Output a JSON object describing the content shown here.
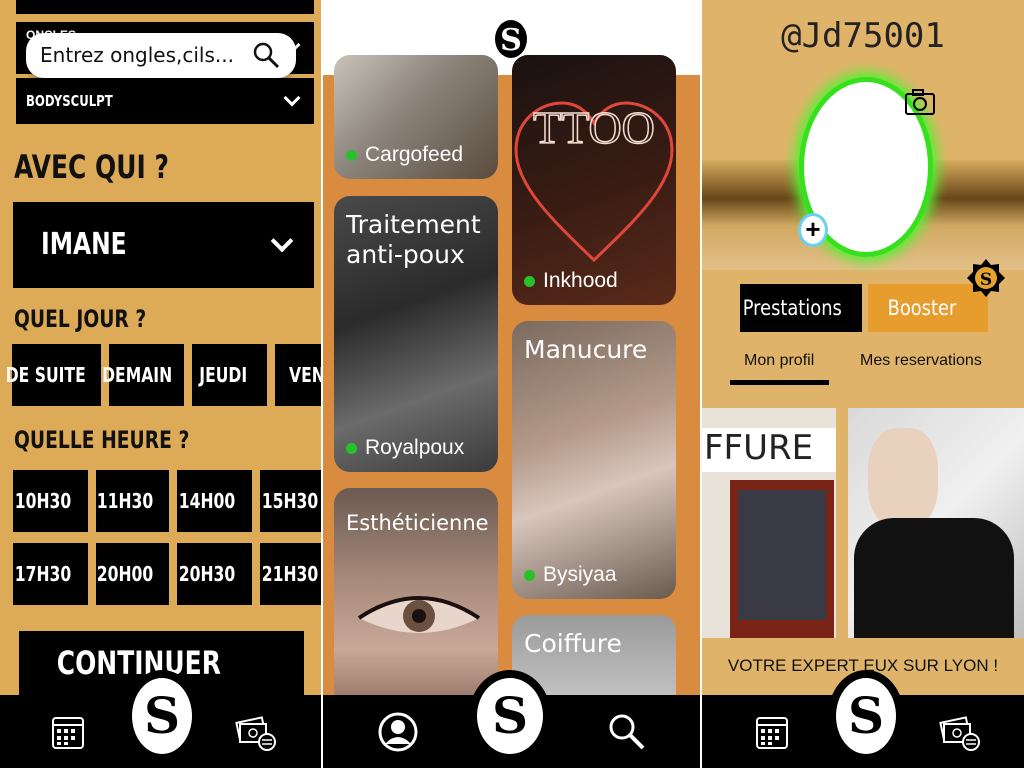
{
  "colors": {
    "gold": "#ddaa58",
    "black": "#000000",
    "online_green": "#28c12b",
    "avatar_ring": "#37e01c",
    "booster_orange": "#e69d2e",
    "grid_orange": "#d98b3f"
  },
  "booking": {
    "top_label_partial": "ONCLES",
    "search": {
      "placeholder": "Entrez ongles,cils...",
      "icon": "search-icon"
    },
    "service_select": {
      "value": "BODYSCULPT",
      "icon": "chevron-down-icon"
    },
    "with_who": {
      "heading": "AVEC QUI ?",
      "value": "IMANE",
      "icon": "chevron-down-icon"
    },
    "day": {
      "heading": "QUEL JOUR ?",
      "options": [
        "DE SUITE",
        "DEMAIN",
        "JEUDI",
        "VEND"
      ]
    },
    "time": {
      "heading": "QUELLE HEURE ?",
      "options": [
        "10H30",
        "11H30",
        "14H00",
        "15H30",
        "17H30",
        "20H00",
        "20H30",
        "21H30"
      ]
    },
    "continue_label": "CONTINUER",
    "nav": {
      "left_icon": "calendar-icon",
      "center_icon": "logo-icon",
      "right_icon": "money-icon"
    }
  },
  "catalog": {
    "logo_letter": "S",
    "tiles": [
      {
        "name": "",
        "shop": "Cargofeed"
      },
      {
        "name": "",
        "shop": "Inkhood",
        "sign": "TTOO"
      },
      {
        "name": "Traitement anti-poux",
        "shop": "Royalpoux"
      },
      {
        "name": "Manucure",
        "shop": "Bysiyaa"
      },
      {
        "name": "Esthéticienne",
        "shop": ""
      },
      {
        "name": "Coiffure",
        "shop": ""
      }
    ],
    "nav": {
      "left_icon": "user-icon",
      "center_icon": "logo-icon",
      "right_icon": "search-icon"
    }
  },
  "profile": {
    "username": "@Jd75001",
    "tabs": {
      "prestations": "Prestations",
      "booster": "Booster"
    },
    "subtabs": {
      "profile": "Mon profil",
      "reservations": "Mes reservations"
    },
    "shop_sign": "FFURE",
    "tagline": "VOTRE EXPERT     EUX SUR LYON !",
    "nav": {
      "left_icon": "calendar-icon",
      "center_icon": "logo-icon",
      "right_icon": "money-icon"
    }
  }
}
